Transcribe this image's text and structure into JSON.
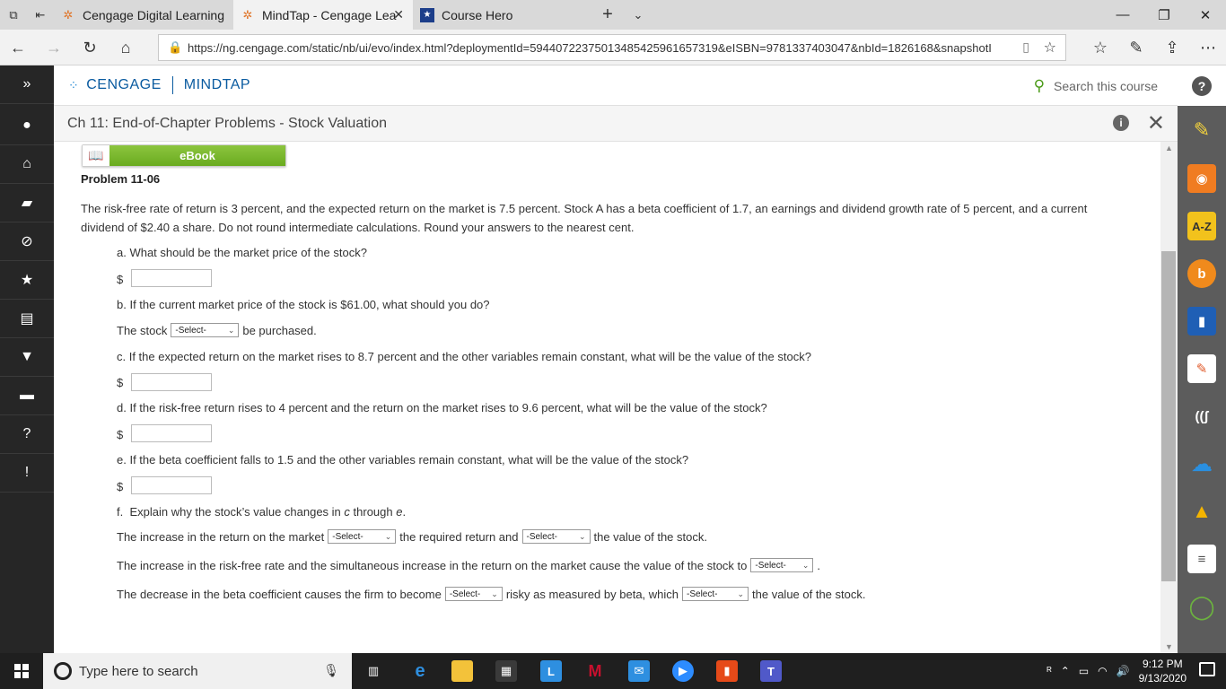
{
  "browser": {
    "tabs": [
      {
        "label": "Cengage Digital Learning",
        "active": false
      },
      {
        "label": "MindTap - Cengage Lea",
        "active": true
      },
      {
        "label": "Course Hero",
        "active": false
      }
    ],
    "url": "https://ng.cengage.com/static/nb/ui/evo/index.html?deploymentId=59440722375013485425961657319&eISBN=9781337403047&nbId=1826168&snapshotI"
  },
  "header": {
    "brand": "CENGAGE",
    "product": "MINDTAP",
    "search_placeholder": "Search this course"
  },
  "activity": {
    "title": "Ch 11: End-of-Chapter Problems - Stock Valuation"
  },
  "problem": {
    "ebook_label": "eBook",
    "title": "Problem 11-06",
    "intro": "The risk-free rate of return is 3 percent, and the expected return on the market is 7.5 percent. Stock A has a beta coefficient of 1.7, an earnings and dividend growth rate of 5 percent, and a current dividend of $2.40 a share. Do not round intermediate calculations. Round your answers to the nearest cent.",
    "dollar": "$",
    "qa": "a.  What should be the market price of the stock?",
    "qb": "b.  If the current market price of the stock is $61.00, what should you do?",
    "qb_pre": "The stock",
    "qb_post": "be purchased.",
    "qc": "c.  If the expected return on the market rises to 8.7 percent and the other variables remain constant, what will be the value of the stock?",
    "qd": "d.  If the risk-free return rises to 4 percent and the return on the market rises to 9.6 percent, what will be the value of the stock?",
    "qe": "e.  If the beta coefficient falls to 1.5 and the other variables remain constant, what will be the value of the stock?",
    "qf_a": "f.  Explain why the stock’s value changes in ",
    "qf_c": "c",
    "qf_mid": " through ",
    "qf_e": "e",
    "qf_end": ".",
    "f1_a": "The increase in the return on the market",
    "f1_b": "the required return and",
    "f1_c": "the value of the stock.",
    "f2_a": "The increase in the risk-free rate and the simultaneous increase in the return on the market cause the value of the stock to",
    "f2_b": ".",
    "f3_a": "The decrease in the beta coefficient causes the firm to become",
    "f3_b": "risky as measured by beta, which",
    "f3_c": "the value of the stock.",
    "select_label": "-Select-"
  },
  "taskbar": {
    "search_placeholder": "Type here to search",
    "time": "9:12 PM",
    "date": "9/13/2020"
  }
}
